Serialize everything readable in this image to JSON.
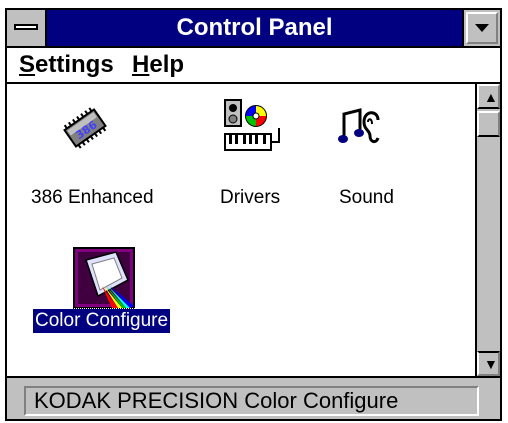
{
  "window": {
    "title": "Control Panel"
  },
  "menubar": {
    "items": [
      {
        "mnemonic": "S",
        "rest": "ettings"
      },
      {
        "mnemonic": "H",
        "rest": "elp"
      }
    ]
  },
  "icons": [
    {
      "label": "386 Enhanced",
      "icon": "chip-386-icon",
      "selected": false
    },
    {
      "label": "Drivers",
      "icon": "drivers-icon",
      "selected": false
    },
    {
      "label": "Sound",
      "icon": "sound-icon",
      "selected": false
    },
    {
      "label": "Color Configure",
      "icon": "color-configure-icon",
      "selected": true
    }
  ],
  "chip_text": "386",
  "statusbar": {
    "text": "KODAK PRECISION Color Configure"
  },
  "colors": {
    "titlebar": "#000080",
    "selection": "#000080",
    "face": "#c0c0c0"
  }
}
